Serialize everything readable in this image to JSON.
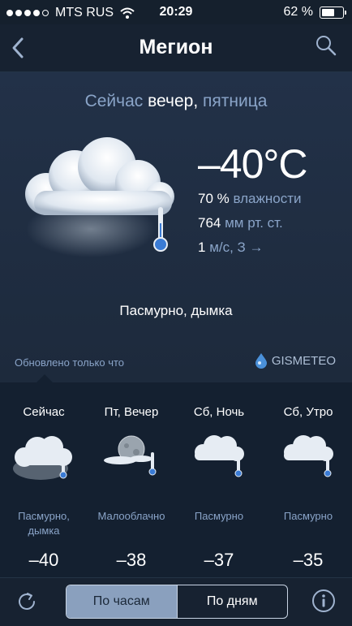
{
  "status_bar": {
    "carrier": "MTS RUS",
    "time": "20:29",
    "battery": "62 %",
    "battery_level": 0.62
  },
  "nav": {
    "title": "Мегион"
  },
  "current": {
    "now_prefix": "Сейчас",
    "now_time": "вечер,",
    "now_day": "пятница",
    "temperature": "–40°C",
    "humidity_value": "70 %",
    "humidity_unit": "влажности",
    "pressure_value": "764",
    "pressure_unit": "мм рт. ст.",
    "wind_value": "1",
    "wind_unit": "м/с, З →",
    "condition": "Пасмурно, дымка",
    "icon": "cloud-fog-thermometer-icon"
  },
  "updated": "Обновлено только что",
  "logo_text": "GISMETEO",
  "forecast": [
    {
      "label": "Сейчас",
      "desc": "Пасмурно,\nдымка",
      "temp": "–40",
      "icon": "cloud-fog-thermometer-icon"
    },
    {
      "label": "Пт, Вечер",
      "desc": "Малооблачно",
      "temp": "–38",
      "icon": "moon-cloud-thermometer-icon"
    },
    {
      "label": "Сб, Ночь",
      "desc": "Пасмурно",
      "temp": "–37",
      "icon": "cloud-thermometer-icon"
    },
    {
      "label": "Сб, Утро",
      "desc": "Пасмурно",
      "temp": "–35",
      "icon": "cloud-thermometer-icon"
    }
  ],
  "toolbar": {
    "hourly_label": "По часам",
    "daily_label": "По дням",
    "active": "hourly"
  },
  "colors": {
    "background": "#1b2838",
    "accent_text": "#8aa4c8",
    "segment_active": "#8aa0be"
  }
}
